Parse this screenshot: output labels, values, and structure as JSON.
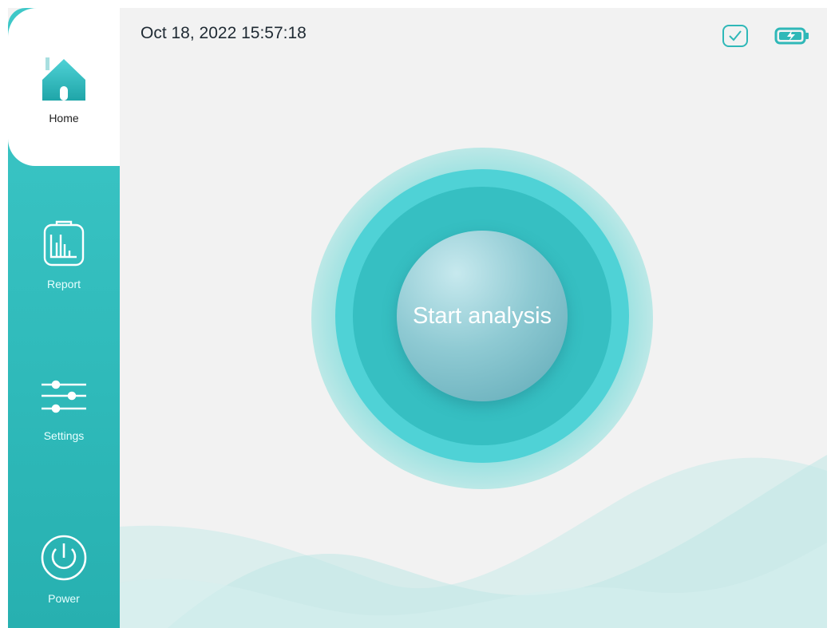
{
  "header": {
    "datetime": "Oct 18, 2022 15:57:18",
    "status_icon": "checkbox-check-icon",
    "battery_icon": "battery-charging-icon"
  },
  "sidebar": {
    "items": [
      {
        "label": "Home",
        "icon": "home-icon",
        "active": true
      },
      {
        "label": "Report",
        "icon": "report-clipboard-icon",
        "active": false
      },
      {
        "label": "Settings",
        "icon": "sliders-icon",
        "active": false
      },
      {
        "label": "Power",
        "icon": "power-icon",
        "active": false
      }
    ]
  },
  "main": {
    "start_button_label": "Start analysis"
  },
  "colors": {
    "accent": "#34c0c0",
    "accent_light": "#4fd2d6",
    "background": "#f2f2f2",
    "text_dark": "#1f2a33"
  }
}
